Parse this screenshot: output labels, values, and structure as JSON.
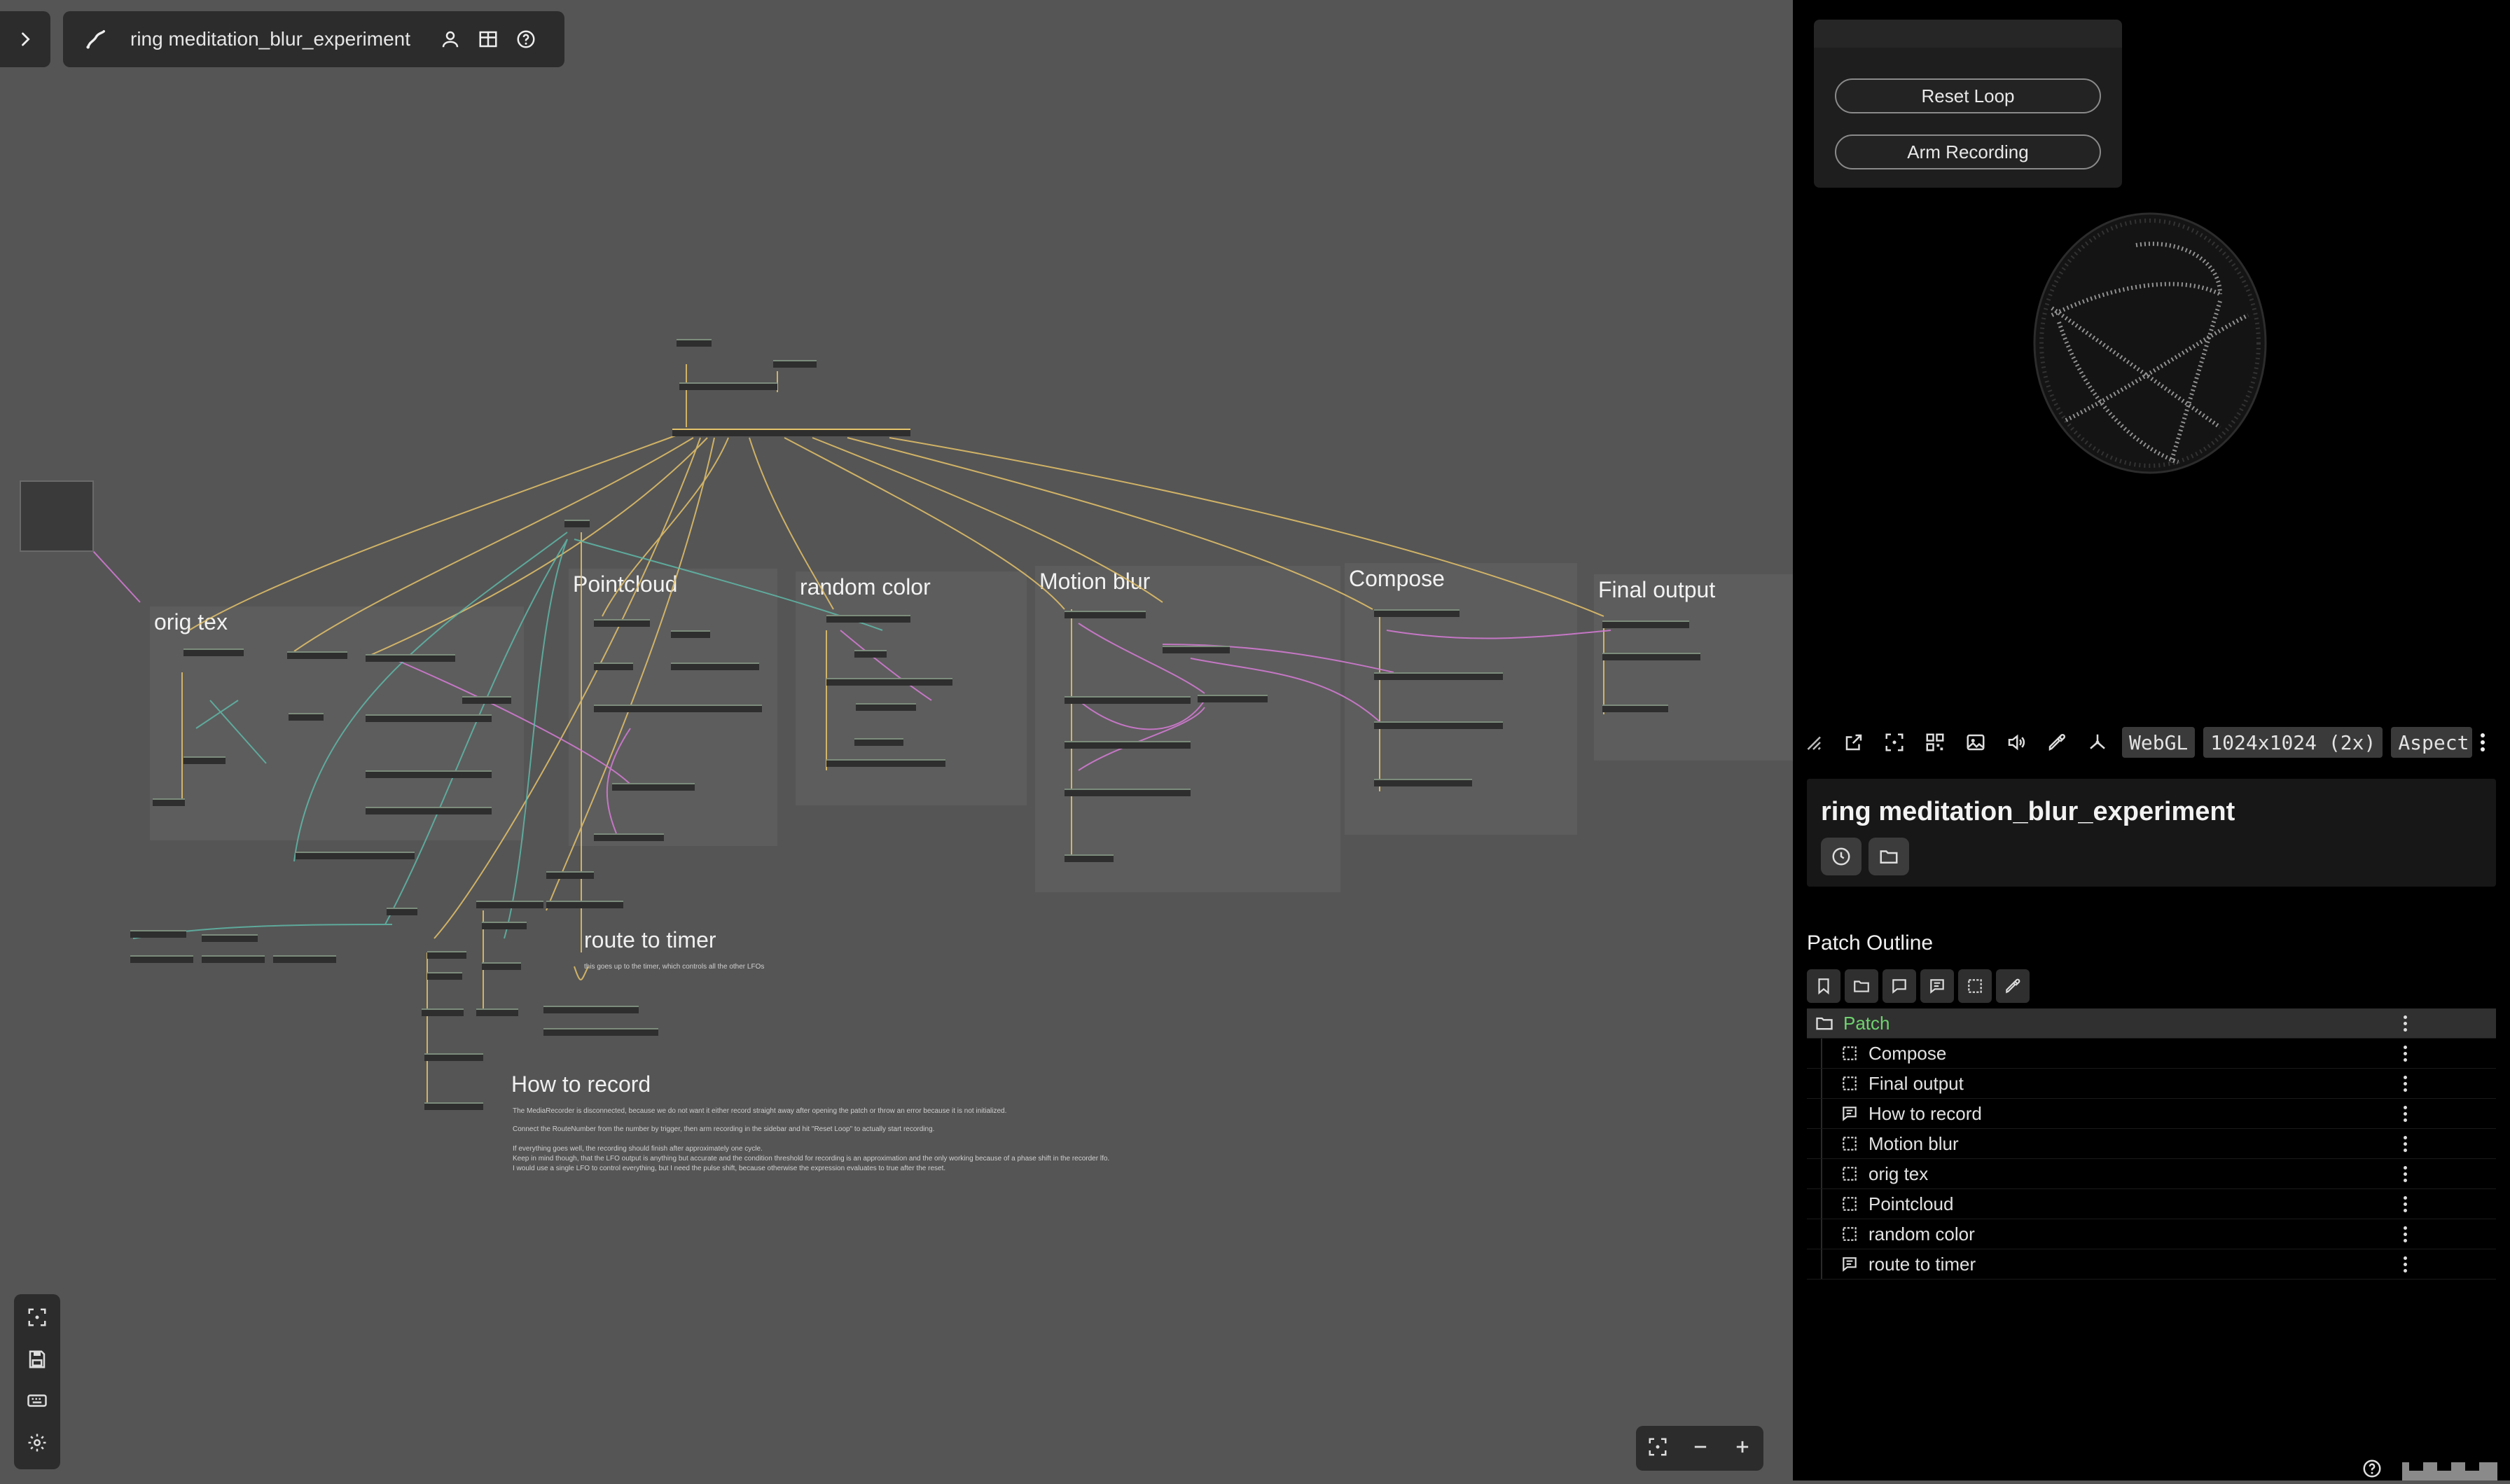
{
  "patch_bar": {
    "title": "ring meditation_blur_experiment"
  },
  "groups": [
    {
      "id": "orig-tex",
      "title": "orig tex"
    },
    {
      "id": "pointcloud",
      "title": "Pointcloud"
    },
    {
      "id": "random-color",
      "title": "random color"
    },
    {
      "id": "motion-blur",
      "title": "Motion blur"
    },
    {
      "id": "compose",
      "title": "Compose"
    },
    {
      "id": "final-output",
      "title": "Final output"
    }
  ],
  "comments": {
    "route_to_timer": {
      "title": "route to timer",
      "text": "this goes up to the timer, which controls all the other LFOs"
    },
    "how_to_record": {
      "title": "How to record",
      "lines": [
        "The MediaRecorder is disconnected, because we do not want it either record straight away after opening the patch or throw an error because it is not initialized.",
        "Connect the RouteNumber from the number by trigger, then arm recording in the sidebar and hit \"Reset Loop\" to actually start recording.",
        "If everything goes well, the recording should finish after approximately one cycle.",
        "Keep in mind though, that the LFO output is anything but accurate and the condition threshold for recording is an approximation and the only working because of a phase shift in the recorder lfo.",
        "I would use a single LFO to control everything, but I need the pulse shift, because otherwise the expression evaluates to true after the reset."
      ]
    }
  },
  "controls": {
    "reset_loop": "Reset Loop",
    "arm_recording": "Arm Recording"
  },
  "viewer_toolbar": {
    "renderer": "WebGL",
    "resolution": "1024x1024 (2x)",
    "aspect": "Aspect"
  },
  "info_card": {
    "title": "ring meditation_blur_experiment"
  },
  "outline": {
    "heading": "Patch Outline",
    "root": "Patch",
    "items": [
      {
        "label": "Compose",
        "kind": "area"
      },
      {
        "label": "Final output",
        "kind": "area"
      },
      {
        "label": "How to record",
        "kind": "comment"
      },
      {
        "label": "Motion blur",
        "kind": "area"
      },
      {
        "label": "orig tex",
        "kind": "area"
      },
      {
        "label": "Pointcloud",
        "kind": "area"
      },
      {
        "label": "random color",
        "kind": "area"
      },
      {
        "label": "route to timer",
        "kind": "comment"
      }
    ]
  },
  "colors": {
    "canvas_bg": "#555555",
    "panel_bg": "#000000",
    "wire_yellow": "#e6c36a",
    "wire_pink": "#d07ad0",
    "wire_teal": "#5fb8a8",
    "accent_green": "#6fd36f"
  }
}
